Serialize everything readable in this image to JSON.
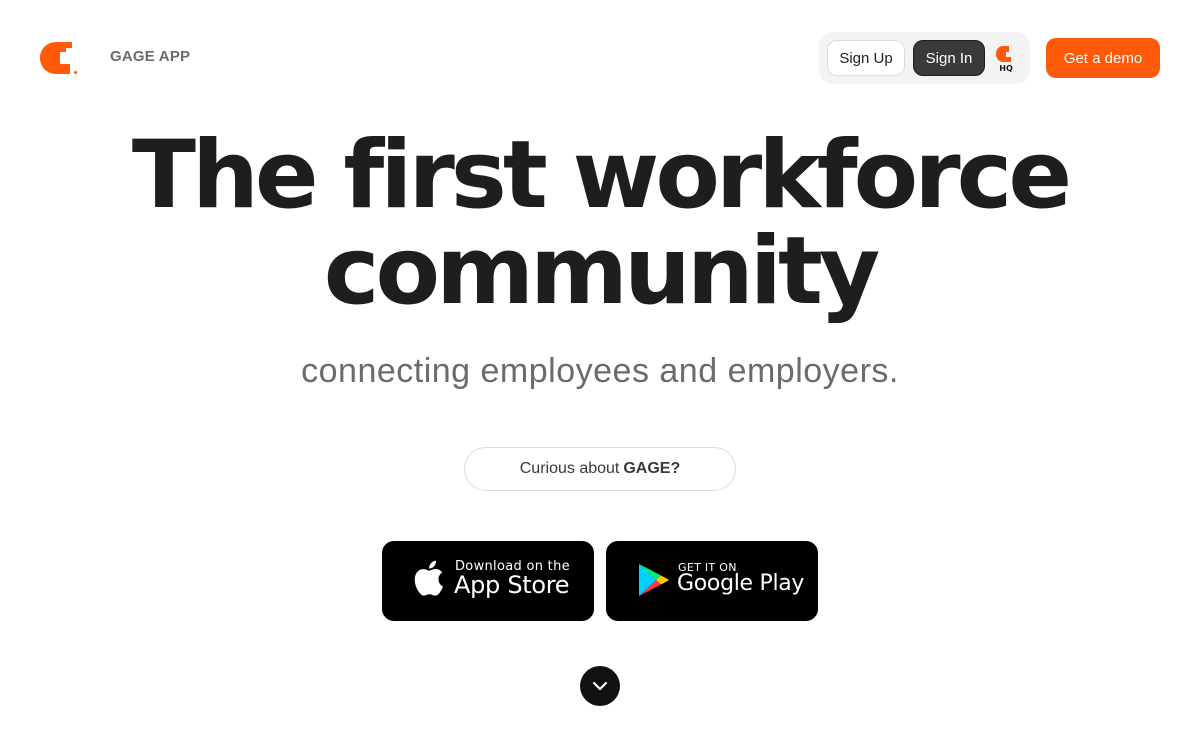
{
  "header": {
    "brand": "GAGE APP",
    "sign_up": "Sign Up",
    "sign_in": "Sign In",
    "hq_label": "HQ",
    "get_demo": "Get a demo"
  },
  "hero": {
    "title_line1": "The first workforce",
    "title_line2": "community",
    "subtitle": "connecting employees and employers."
  },
  "curious": {
    "prefix": "Curious about",
    "emphasis": "GAGE?"
  },
  "stores": {
    "apple_small": "Download on the",
    "apple_big": "App Store",
    "google_small": "GET IT ON",
    "google_big": "Google Play"
  },
  "icons": {
    "logo": "gage-logo-icon",
    "hq": "gage-hq-icon",
    "apple": "apple-icon",
    "google_play": "google-play-icon",
    "scroll": "chevron-down-icon"
  },
  "colors": {
    "accent": "#ff5a0a",
    "text": "#1e1e1e",
    "muted": "#6b6b6b"
  }
}
